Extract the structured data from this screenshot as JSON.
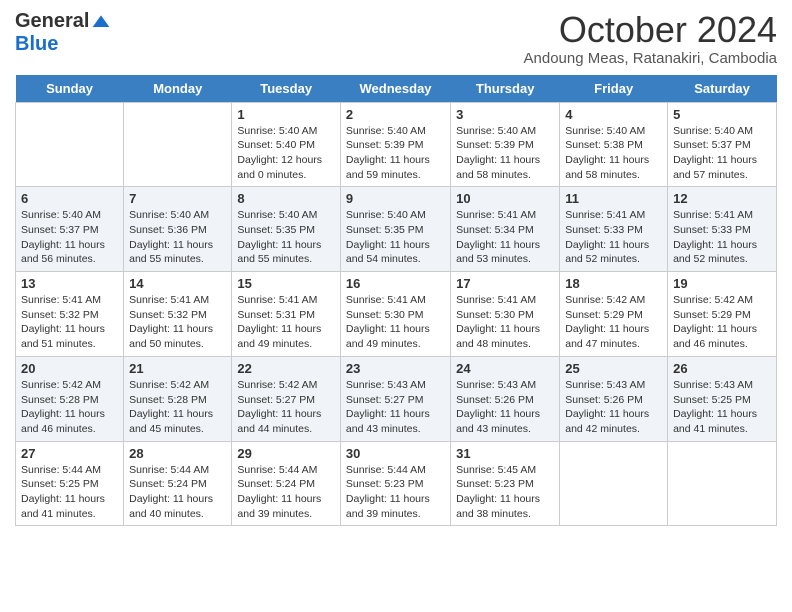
{
  "header": {
    "logo_general": "General",
    "logo_blue": "Blue",
    "month_title": "October 2024",
    "subtitle": "Andoung Meas, Ratanakiri, Cambodia"
  },
  "days_of_week": [
    "Sunday",
    "Monday",
    "Tuesday",
    "Wednesday",
    "Thursday",
    "Friday",
    "Saturday"
  ],
  "weeks": [
    [
      {
        "day": "",
        "text": ""
      },
      {
        "day": "",
        "text": ""
      },
      {
        "day": "1",
        "text": "Sunrise: 5:40 AM\nSunset: 5:40 PM\nDaylight: 12 hours and 0 minutes."
      },
      {
        "day": "2",
        "text": "Sunrise: 5:40 AM\nSunset: 5:39 PM\nDaylight: 11 hours and 59 minutes."
      },
      {
        "day": "3",
        "text": "Sunrise: 5:40 AM\nSunset: 5:39 PM\nDaylight: 11 hours and 58 minutes."
      },
      {
        "day": "4",
        "text": "Sunrise: 5:40 AM\nSunset: 5:38 PM\nDaylight: 11 hours and 58 minutes."
      },
      {
        "day": "5",
        "text": "Sunrise: 5:40 AM\nSunset: 5:37 PM\nDaylight: 11 hours and 57 minutes."
      }
    ],
    [
      {
        "day": "6",
        "text": "Sunrise: 5:40 AM\nSunset: 5:37 PM\nDaylight: 11 hours and 56 minutes."
      },
      {
        "day": "7",
        "text": "Sunrise: 5:40 AM\nSunset: 5:36 PM\nDaylight: 11 hours and 55 minutes."
      },
      {
        "day": "8",
        "text": "Sunrise: 5:40 AM\nSunset: 5:35 PM\nDaylight: 11 hours and 55 minutes."
      },
      {
        "day": "9",
        "text": "Sunrise: 5:40 AM\nSunset: 5:35 PM\nDaylight: 11 hours and 54 minutes."
      },
      {
        "day": "10",
        "text": "Sunrise: 5:41 AM\nSunset: 5:34 PM\nDaylight: 11 hours and 53 minutes."
      },
      {
        "day": "11",
        "text": "Sunrise: 5:41 AM\nSunset: 5:33 PM\nDaylight: 11 hours and 52 minutes."
      },
      {
        "day": "12",
        "text": "Sunrise: 5:41 AM\nSunset: 5:33 PM\nDaylight: 11 hours and 52 minutes."
      }
    ],
    [
      {
        "day": "13",
        "text": "Sunrise: 5:41 AM\nSunset: 5:32 PM\nDaylight: 11 hours and 51 minutes."
      },
      {
        "day": "14",
        "text": "Sunrise: 5:41 AM\nSunset: 5:32 PM\nDaylight: 11 hours and 50 minutes."
      },
      {
        "day": "15",
        "text": "Sunrise: 5:41 AM\nSunset: 5:31 PM\nDaylight: 11 hours and 49 minutes."
      },
      {
        "day": "16",
        "text": "Sunrise: 5:41 AM\nSunset: 5:30 PM\nDaylight: 11 hours and 49 minutes."
      },
      {
        "day": "17",
        "text": "Sunrise: 5:41 AM\nSunset: 5:30 PM\nDaylight: 11 hours and 48 minutes."
      },
      {
        "day": "18",
        "text": "Sunrise: 5:42 AM\nSunset: 5:29 PM\nDaylight: 11 hours and 47 minutes."
      },
      {
        "day": "19",
        "text": "Sunrise: 5:42 AM\nSunset: 5:29 PM\nDaylight: 11 hours and 46 minutes."
      }
    ],
    [
      {
        "day": "20",
        "text": "Sunrise: 5:42 AM\nSunset: 5:28 PM\nDaylight: 11 hours and 46 minutes."
      },
      {
        "day": "21",
        "text": "Sunrise: 5:42 AM\nSunset: 5:28 PM\nDaylight: 11 hours and 45 minutes."
      },
      {
        "day": "22",
        "text": "Sunrise: 5:42 AM\nSunset: 5:27 PM\nDaylight: 11 hours and 44 minutes."
      },
      {
        "day": "23",
        "text": "Sunrise: 5:43 AM\nSunset: 5:27 PM\nDaylight: 11 hours and 43 minutes."
      },
      {
        "day": "24",
        "text": "Sunrise: 5:43 AM\nSunset: 5:26 PM\nDaylight: 11 hours and 43 minutes."
      },
      {
        "day": "25",
        "text": "Sunrise: 5:43 AM\nSunset: 5:26 PM\nDaylight: 11 hours and 42 minutes."
      },
      {
        "day": "26",
        "text": "Sunrise: 5:43 AM\nSunset: 5:25 PM\nDaylight: 11 hours and 41 minutes."
      }
    ],
    [
      {
        "day": "27",
        "text": "Sunrise: 5:44 AM\nSunset: 5:25 PM\nDaylight: 11 hours and 41 minutes."
      },
      {
        "day": "28",
        "text": "Sunrise: 5:44 AM\nSunset: 5:24 PM\nDaylight: 11 hours and 40 minutes."
      },
      {
        "day": "29",
        "text": "Sunrise: 5:44 AM\nSunset: 5:24 PM\nDaylight: 11 hours and 39 minutes."
      },
      {
        "day": "30",
        "text": "Sunrise: 5:44 AM\nSunset: 5:23 PM\nDaylight: 11 hours and 39 minutes."
      },
      {
        "day": "31",
        "text": "Sunrise: 5:45 AM\nSunset: 5:23 PM\nDaylight: 11 hours and 38 minutes."
      },
      {
        "day": "",
        "text": ""
      },
      {
        "day": "",
        "text": ""
      }
    ]
  ]
}
